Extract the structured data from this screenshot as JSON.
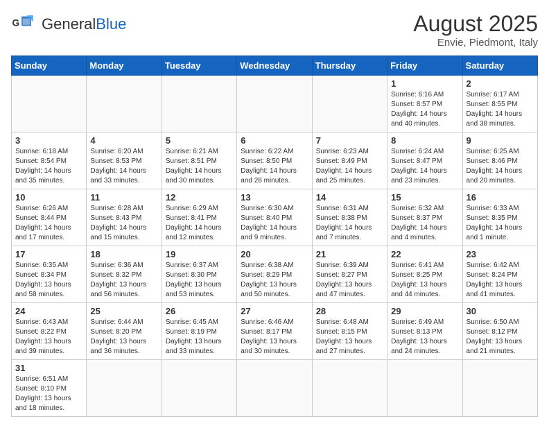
{
  "header": {
    "logo_text_general": "General",
    "logo_text_blue": "Blue",
    "month_year": "August 2025",
    "location": "Envie, Piedmont, Italy"
  },
  "weekdays": [
    "Sunday",
    "Monday",
    "Tuesday",
    "Wednesday",
    "Thursday",
    "Friday",
    "Saturday"
  ],
  "weeks": [
    {
      "days": [
        {
          "number": "",
          "info": ""
        },
        {
          "number": "",
          "info": ""
        },
        {
          "number": "",
          "info": ""
        },
        {
          "number": "",
          "info": ""
        },
        {
          "number": "",
          "info": ""
        },
        {
          "number": "1",
          "info": "Sunrise: 6:16 AM\nSunset: 8:57 PM\nDaylight: 14 hours and 40 minutes."
        },
        {
          "number": "2",
          "info": "Sunrise: 6:17 AM\nSunset: 8:55 PM\nDaylight: 14 hours and 38 minutes."
        }
      ]
    },
    {
      "days": [
        {
          "number": "3",
          "info": "Sunrise: 6:18 AM\nSunset: 8:54 PM\nDaylight: 14 hours and 35 minutes."
        },
        {
          "number": "4",
          "info": "Sunrise: 6:20 AM\nSunset: 8:53 PM\nDaylight: 14 hours and 33 minutes."
        },
        {
          "number": "5",
          "info": "Sunrise: 6:21 AM\nSunset: 8:51 PM\nDaylight: 14 hours and 30 minutes."
        },
        {
          "number": "6",
          "info": "Sunrise: 6:22 AM\nSunset: 8:50 PM\nDaylight: 14 hours and 28 minutes."
        },
        {
          "number": "7",
          "info": "Sunrise: 6:23 AM\nSunset: 8:49 PM\nDaylight: 14 hours and 25 minutes."
        },
        {
          "number": "8",
          "info": "Sunrise: 6:24 AM\nSunset: 8:47 PM\nDaylight: 14 hours and 23 minutes."
        },
        {
          "number": "9",
          "info": "Sunrise: 6:25 AM\nSunset: 8:46 PM\nDaylight: 14 hours and 20 minutes."
        }
      ]
    },
    {
      "days": [
        {
          "number": "10",
          "info": "Sunrise: 6:26 AM\nSunset: 8:44 PM\nDaylight: 14 hours and 17 minutes."
        },
        {
          "number": "11",
          "info": "Sunrise: 6:28 AM\nSunset: 8:43 PM\nDaylight: 14 hours and 15 minutes."
        },
        {
          "number": "12",
          "info": "Sunrise: 6:29 AM\nSunset: 8:41 PM\nDaylight: 14 hours and 12 minutes."
        },
        {
          "number": "13",
          "info": "Sunrise: 6:30 AM\nSunset: 8:40 PM\nDaylight: 14 hours and 9 minutes."
        },
        {
          "number": "14",
          "info": "Sunrise: 6:31 AM\nSunset: 8:38 PM\nDaylight: 14 hours and 7 minutes."
        },
        {
          "number": "15",
          "info": "Sunrise: 6:32 AM\nSunset: 8:37 PM\nDaylight: 14 hours and 4 minutes."
        },
        {
          "number": "16",
          "info": "Sunrise: 6:33 AM\nSunset: 8:35 PM\nDaylight: 14 hours and 1 minute."
        }
      ]
    },
    {
      "days": [
        {
          "number": "17",
          "info": "Sunrise: 6:35 AM\nSunset: 8:34 PM\nDaylight: 13 hours and 58 minutes."
        },
        {
          "number": "18",
          "info": "Sunrise: 6:36 AM\nSunset: 8:32 PM\nDaylight: 13 hours and 56 minutes."
        },
        {
          "number": "19",
          "info": "Sunrise: 6:37 AM\nSunset: 8:30 PM\nDaylight: 13 hours and 53 minutes."
        },
        {
          "number": "20",
          "info": "Sunrise: 6:38 AM\nSunset: 8:29 PM\nDaylight: 13 hours and 50 minutes."
        },
        {
          "number": "21",
          "info": "Sunrise: 6:39 AM\nSunset: 8:27 PM\nDaylight: 13 hours and 47 minutes."
        },
        {
          "number": "22",
          "info": "Sunrise: 6:41 AM\nSunset: 8:25 PM\nDaylight: 13 hours and 44 minutes."
        },
        {
          "number": "23",
          "info": "Sunrise: 6:42 AM\nSunset: 8:24 PM\nDaylight: 13 hours and 41 minutes."
        }
      ]
    },
    {
      "days": [
        {
          "number": "24",
          "info": "Sunrise: 6:43 AM\nSunset: 8:22 PM\nDaylight: 13 hours and 39 minutes."
        },
        {
          "number": "25",
          "info": "Sunrise: 6:44 AM\nSunset: 8:20 PM\nDaylight: 13 hours and 36 minutes."
        },
        {
          "number": "26",
          "info": "Sunrise: 6:45 AM\nSunset: 8:19 PM\nDaylight: 13 hours and 33 minutes."
        },
        {
          "number": "27",
          "info": "Sunrise: 6:46 AM\nSunset: 8:17 PM\nDaylight: 13 hours and 30 minutes."
        },
        {
          "number": "28",
          "info": "Sunrise: 6:48 AM\nSunset: 8:15 PM\nDaylight: 13 hours and 27 minutes."
        },
        {
          "number": "29",
          "info": "Sunrise: 6:49 AM\nSunset: 8:13 PM\nDaylight: 13 hours and 24 minutes."
        },
        {
          "number": "30",
          "info": "Sunrise: 6:50 AM\nSunset: 8:12 PM\nDaylight: 13 hours and 21 minutes."
        }
      ]
    },
    {
      "days": [
        {
          "number": "31",
          "info": "Sunrise: 6:51 AM\nSunset: 8:10 PM\nDaylight: 13 hours and 18 minutes."
        },
        {
          "number": "",
          "info": ""
        },
        {
          "number": "",
          "info": ""
        },
        {
          "number": "",
          "info": ""
        },
        {
          "number": "",
          "info": ""
        },
        {
          "number": "",
          "info": ""
        },
        {
          "number": "",
          "info": ""
        }
      ]
    }
  ]
}
